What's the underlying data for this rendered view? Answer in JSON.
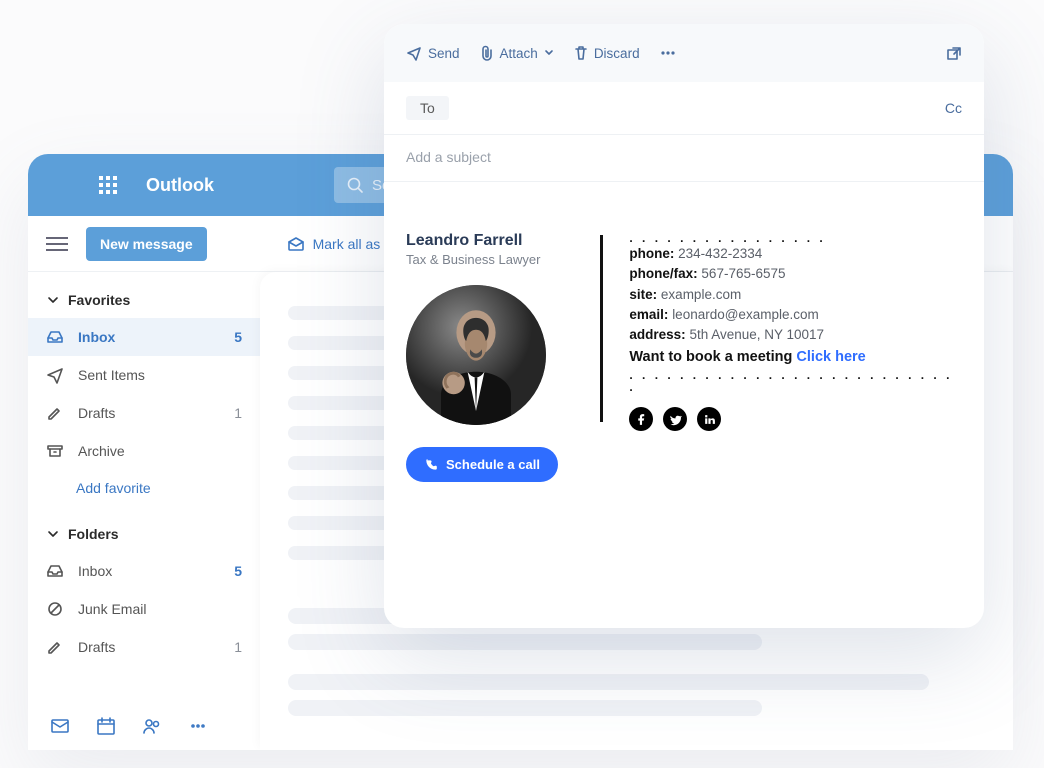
{
  "app": {
    "title": "Outlook",
    "search_placeholder": "Search",
    "toolbar": {
      "new_message": "New message",
      "mark_all_read": "Mark all as read"
    },
    "sidebar": {
      "favorites_header": "Favorites",
      "folders_header": "Folders",
      "add_favorite": "Add favorite",
      "favorites": [
        {
          "name": "inbox",
          "label": "Inbox",
          "count": "5",
          "active": true
        },
        {
          "name": "sent",
          "label": "Sent Items"
        },
        {
          "name": "drafts",
          "label": "Drafts",
          "count": "1",
          "dim": true
        },
        {
          "name": "archive",
          "label": "Archive"
        }
      ],
      "folders": [
        {
          "name": "inbox2",
          "label": "Inbox",
          "count": "5"
        },
        {
          "name": "junk",
          "label": "Junk Email"
        },
        {
          "name": "drafts2",
          "label": "Drafts",
          "count": "1",
          "dim": true
        }
      ]
    }
  },
  "compose": {
    "actions": {
      "send": "Send",
      "attach": "Attach",
      "discard": "Discard"
    },
    "to_label": "To",
    "cc_label": "Cc",
    "subject_placeholder": "Add a subject",
    "signature": {
      "name": "Leandro Farrell",
      "title": "Tax & Business Lawyer",
      "schedule_label": "Schedule a call",
      "contacts": {
        "phone_label": "phone:",
        "phone": "234-432-2334",
        "fax_label": "phone/fax:",
        "fax": "567-765-6575",
        "site_label": "site:",
        "site": "example.com",
        "email_label": "email:",
        "email": "leonardo@example.com",
        "addr_label": "address:",
        "addr": "5th Avenue, NY 10017"
      },
      "book_text": "Want to book a meeting",
      "book_link": "Click here",
      "socials": {
        "facebook": "facebook-icon",
        "twitter": "twitter-icon",
        "linkedin": "linkedin-icon"
      }
    }
  }
}
